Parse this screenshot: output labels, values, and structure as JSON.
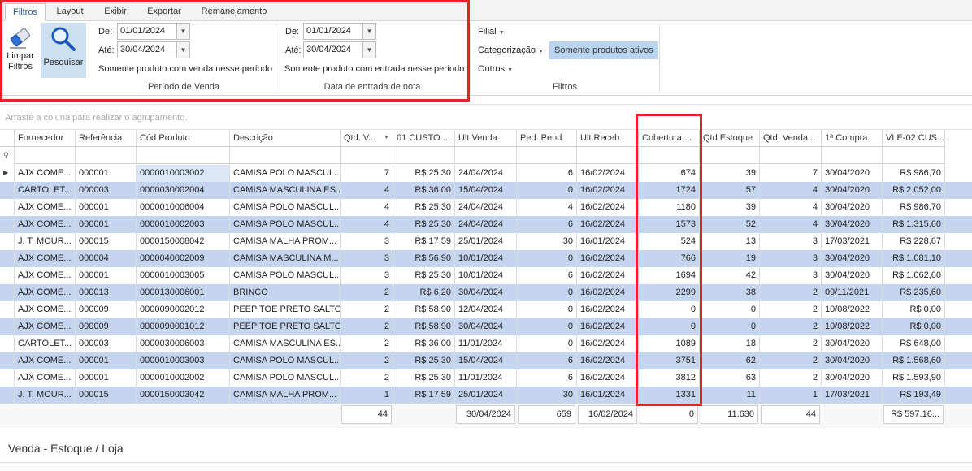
{
  "ribbon": {
    "tabs": [
      "Filtros",
      "Layout",
      "Exibir",
      "Exportar",
      "Remanejamento"
    ],
    "clear_label_1": "Limpar",
    "clear_label_2": "Filtros",
    "search_label": "Pesquisar",
    "venda": {
      "from_label": "De:",
      "from_value": "01/01/2024",
      "to_label": "Até:",
      "to_value": "30/04/2024",
      "only_label": "Somente produto com venda nesse período",
      "caption": "Período de Venda"
    },
    "entrada": {
      "from_label": "De:",
      "from_value": "01/01/2024",
      "to_label": "Até:",
      "to_value": "30/04/2024",
      "only_label": "Somente produto com entrada nesse período",
      "caption": "Data de entrada de nota"
    },
    "filtros": {
      "filial": "Filial",
      "categorizacao": "Categorização",
      "outros": "Outros",
      "ativos": "Somente produtos ativos",
      "caption": "Filtros"
    }
  },
  "group_hint": "Arraste a coluna para realizar o agrupamento.",
  "grid": {
    "headers": [
      "Fornecedor",
      "Referência",
      "Cód Produto",
      "Descrição",
      "Qtd. V...",
      "01 CUSTO ...",
      "Ult.Venda",
      "Ped. Pend.",
      "Ult.Receb.",
      "Cobertura ...",
      "Qtd Estoque",
      "Qtd. Venda...",
      "1ª Compra",
      "VLE-02 CUS..."
    ],
    "rows": [
      [
        "AJX COME...",
        "000001",
        "0000010003002",
        "CAMISA POLO MASCUL...",
        "7",
        "R$ 25,30",
        "24/04/2024",
        "6",
        "16/02/2024",
        "674",
        "39",
        "7",
        "30/04/2020",
        "R$ 986,70"
      ],
      [
        "CARTOLET...",
        "000003",
        "0000030002004",
        "CAMISA MASCULINA ES...",
        "4",
        "R$ 36,00",
        "15/04/2024",
        "0",
        "16/02/2024",
        "1724",
        "57",
        "4",
        "30/04/2020",
        "R$ 2.052,00"
      ],
      [
        "AJX COME...",
        "000001",
        "0000010006004",
        "CAMISA POLO MASCUL...",
        "4",
        "R$ 25,30",
        "24/04/2024",
        "4",
        "16/02/2024",
        "1180",
        "39",
        "4",
        "30/04/2020",
        "R$ 986,70"
      ],
      [
        "AJX COME...",
        "000001",
        "0000010002003",
        "CAMISA POLO MASCUL...",
        "4",
        "R$ 25,30",
        "24/04/2024",
        "6",
        "16/02/2024",
        "1573",
        "52",
        "4",
        "30/04/2020",
        "R$ 1.315,60"
      ],
      [
        "J. T. MOUR...",
        "000015",
        "0000150008042",
        "CAMISA MALHA PROM...",
        "3",
        "R$ 17,59",
        "25/01/2024",
        "30",
        "16/01/2024",
        "524",
        "13",
        "3",
        "17/03/2021",
        "R$ 228,67"
      ],
      [
        "AJX COME...",
        "000004",
        "0000040002009",
        "CAMISA MASCULINA M...",
        "3",
        "R$ 56,90",
        "10/01/2024",
        "0",
        "16/02/2024",
        "766",
        "19",
        "3",
        "30/04/2020",
        "R$ 1.081,10"
      ],
      [
        "AJX COME...",
        "000001",
        "0000010003005",
        "CAMISA POLO MASCUL...",
        "3",
        "R$ 25,30",
        "10/01/2024",
        "6",
        "16/02/2024",
        "1694",
        "42",
        "3",
        "30/04/2020",
        "R$ 1.062,60"
      ],
      [
        "AJX COME...",
        "000013",
        "0000130006001",
        "BRINCO",
        "2",
        "R$ 6,20",
        "30/04/2024",
        "0",
        "16/02/2024",
        "2299",
        "38",
        "2",
        "09/11/2021",
        "R$ 235,60"
      ],
      [
        "AJX COME...",
        "000009",
        "0000090002012",
        "PEEP TOE PRETO SALTO",
        "2",
        "R$ 58,90",
        "12/04/2024",
        "0",
        "16/02/2024",
        "0",
        "0",
        "2",
        "10/08/2022",
        "R$ 0,00"
      ],
      [
        "AJX COME...",
        "000009",
        "0000090001012",
        "PEEP TOE PRETO SALTO",
        "2",
        "R$ 58,90",
        "30/04/2024",
        "0",
        "16/02/2024",
        "0",
        "0",
        "2",
        "10/08/2022",
        "R$ 0,00"
      ],
      [
        "CARTOLET...",
        "000003",
        "0000030006003",
        "CAMISA MASCULINA ES...",
        "2",
        "R$ 36,00",
        "11/01/2024",
        "0",
        "16/02/2024",
        "1089",
        "18",
        "2",
        "30/04/2020",
        "R$ 648,00"
      ],
      [
        "AJX COME...",
        "000001",
        "0000010003003",
        "CAMISA POLO MASCUL...",
        "2",
        "R$ 25,30",
        "15/04/2024",
        "6",
        "16/02/2024",
        "3751",
        "62",
        "2",
        "30/04/2020",
        "R$ 1.568,60"
      ],
      [
        "AJX COME...",
        "000001",
        "0000010002002",
        "CAMISA POLO MASCUL...",
        "2",
        "R$ 25,30",
        "11/01/2024",
        "6",
        "16/02/2024",
        "3812",
        "63",
        "2",
        "30/04/2020",
        "R$ 1.593,90"
      ],
      [
        "J. T. MOUR...",
        "000015",
        "0000150003042",
        "CAMISA MALHA PROM...",
        "1",
        "R$ 17,59",
        "25/01/2024",
        "30",
        "16/01/2024",
        "1331",
        "11",
        "1",
        "17/03/2021",
        "R$ 193,49"
      ]
    ],
    "footer": [
      "",
      "",
      "",
      "",
      "44",
      "",
      "30/04/2024",
      "659",
      "16/02/2024",
      "0",
      "11.630",
      "44",
      "",
      "R$ 597.16..."
    ]
  },
  "panel_title": "Venda - Estoque / Loja",
  "colors": {
    "highlight_box": "#e8202a",
    "odd_row": "#c5d5ef",
    "selected_button": "#cde0f2",
    "toggle_active": "#b9d4ef"
  }
}
